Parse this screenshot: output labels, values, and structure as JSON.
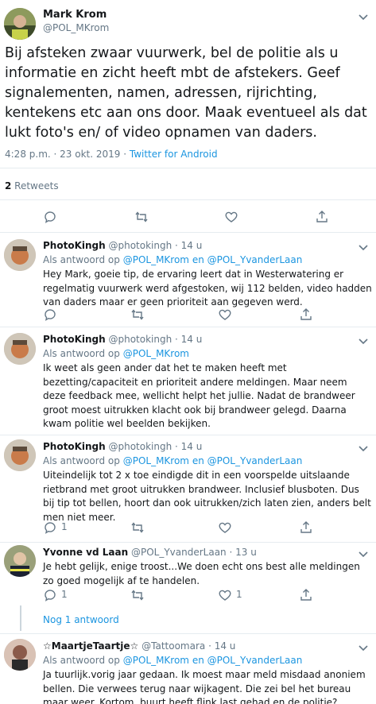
{
  "main_tweet": {
    "name": "Mark Krom",
    "handle": "@POL_MKrom",
    "text": "Bij afsteken zwaar vuurwerk, bel de politie als u informatie en zicht heeft mbt de afstekers. Geef signalementen,  namen, adressen, rijrichting, kentekens etc aan ons door. Maak eventueel als dat lukt foto's en/ of  video opnamen van daders.",
    "time": "4:28 p.m. · 23 okt. 2019 · ",
    "source": "Twitter for Android",
    "retweet_count": "2",
    "retweet_label": " Retweets"
  },
  "replies": [
    {
      "name": "PhotoKingh",
      "handle": "@photokingh",
      "time": "· 14 u",
      "reply_prefix": "Als antwoord op ",
      "reply_to_1": "@POL_MKrom",
      "reply_joiner": " en ",
      "reply_to_2": "@POL_YvanderLaan",
      "text": "Hey Mark, goeie tip, de ervaring leert dat in Westerwatering er regelmatig vuurwerk werd afgestoken, wij 112 belden, video hadden van daders maar er geen prioriteit aan gegeven werd."
    },
    {
      "name": "PhotoKingh",
      "handle": "@photokingh",
      "time": "· 14 u",
      "reply_prefix": "Als antwoord op ",
      "reply_to_1": "@POL_MKrom",
      "text": "Ik weet als geen ander dat het te maken heeft met bezetting/capaciteit en prioriteit andere meldingen. Maar neem deze feedback mee, wellicht helpt het jullie. Nadat de brandweer groot moest uitrukken klacht ook bij brandweer gelegd. Daarna kwam politie wel beelden bekijken."
    },
    {
      "name": "PhotoKingh",
      "handle": "@photokingh",
      "time": "· 14 u",
      "reply_prefix": "Als antwoord op ",
      "reply_to_1": "@POL_MKrom",
      "reply_joiner": " en ",
      "reply_to_2": "@POL_YvanderLaan",
      "text": "Uiteindelijk tot 2 x toe eindigde dit in een voorspelde uitslaande rietbrand met groot uitrukken brandweer. Inclusief blusboten. Dus bij tip tot bellen, hoort dan ook uitrukken/zich laten zien, anders belt men niet meer.",
      "reply_count": "1"
    },
    {
      "name": "Yvonne vd Laan",
      "handle": "@POL_YvanderLaan",
      "time": "· 13 u",
      "text": "Je hebt gelijk, enige troost...We doen echt ons best alle meldingen zo goed mogelijk af te handelen.",
      "reply_count": "1",
      "like_count": "1"
    },
    {
      "name": "☆MaartjeTaartje☆",
      "handle": "@Tattoomara",
      "time": "· 14 u",
      "reply_prefix": "Als antwoord op ",
      "reply_to_1": "@POL_MKrom",
      "reply_joiner": " en ",
      "reply_to_2": "@POL_YvanderLaan",
      "text": "Ja tuurlijk.vorig jaar gedaan. Ik moest maar meld misdaad anoniem bellen. Die verwees terug naar wijkagent. Die zei bel het bureau maar weer. Kortom, buurt heeft flink last gehad en de politie?"
    }
  ],
  "more_replies_link": "Nog 1 antwoord",
  "colors": {
    "link": "#1b95e0",
    "muted": "#657786",
    "text": "#14171a",
    "divider": "#e6ecf0"
  }
}
